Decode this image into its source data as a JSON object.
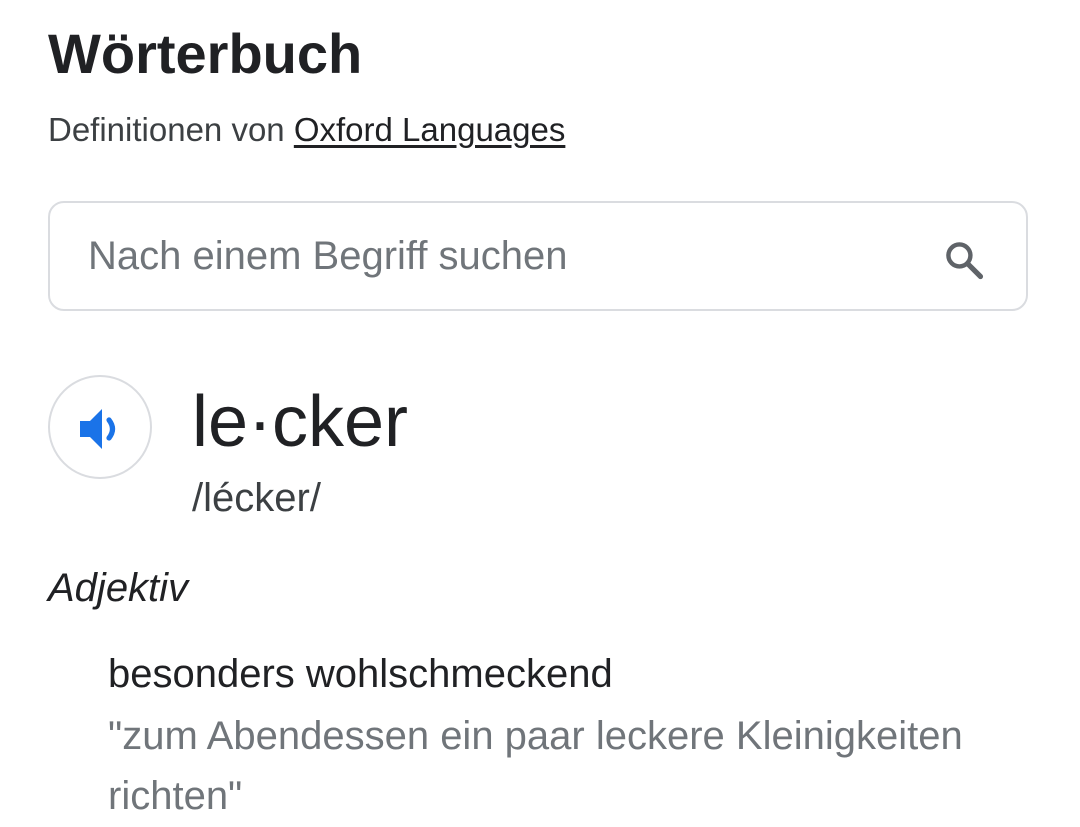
{
  "header": {
    "title": "Wörterbuch",
    "source_prefix": "Definitionen von ",
    "source_link": "Oxford Languages"
  },
  "search": {
    "value": "",
    "placeholder": "Nach einem Begriff suchen",
    "icon": "search-icon"
  },
  "entry": {
    "audio_icon": "speaker-icon",
    "word": "le·cker",
    "phonetic": "/lécker/",
    "part_of_speech": "Adjektiv",
    "definition": "besonders wohlschmeckend",
    "example": "\"zum Abendessen ein paar leckere Kleinigkeiten richten\""
  },
  "colors": {
    "accent": "#1a73e8",
    "text": "#202124",
    "secondary_text": "#70757a",
    "border": "#dadce0"
  }
}
